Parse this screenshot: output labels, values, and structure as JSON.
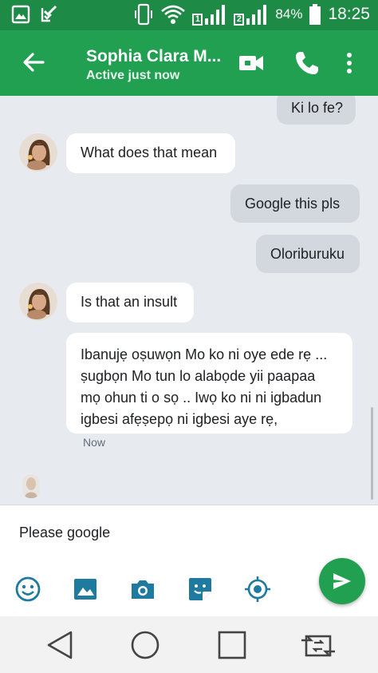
{
  "status_bar": {
    "battery_percent": "84%",
    "time": "18:25",
    "sim_slot_1": "1",
    "sim_slot_2": "2",
    "icons": [
      "gallery-icon",
      "checklist-icon",
      "phone-vibrate-icon",
      "wifi-icon",
      "signal-icon",
      "battery-icon"
    ]
  },
  "header": {
    "contact_name": "Sophia Clara M...",
    "status": "Active just now",
    "actions": [
      "video-call-icon",
      "phone-call-icon",
      "more-vert-icon"
    ],
    "accent_color": "#21a051"
  },
  "messages": [
    {
      "direction": "outgoing",
      "text": "Ki lo fe?"
    },
    {
      "direction": "incoming",
      "text": "What does that mean"
    },
    {
      "direction": "outgoing",
      "text": "Google this pls"
    },
    {
      "direction": "outgoing",
      "text": "Oloriburuku"
    },
    {
      "direction": "incoming",
      "text": "Is that an insult"
    },
    {
      "direction": "incoming",
      "lines": [
        "Ibanujẹ oṣuwọn Mo ko ni oye ede rẹ ...",
        "ṣugbọn Mo tun lo alabọde yii paapaa",
        "mọ ohun ti o sọ .. Iwọ ko ni ni igbadun",
        "igbesi afẹṣepọ ni igbesi aye rẹ,"
      ]
    }
  ],
  "last_message_time": "Now",
  "composer": {
    "text": "Please google",
    "tools": [
      "emoji-icon",
      "image-icon",
      "camera-icon",
      "sticker-icon",
      "location-icon"
    ],
    "send": "send-icon"
  },
  "nav_bar": [
    "back-triangle-icon",
    "home-circle-icon",
    "recents-square-icon",
    "switch-sim-icon"
  ]
}
